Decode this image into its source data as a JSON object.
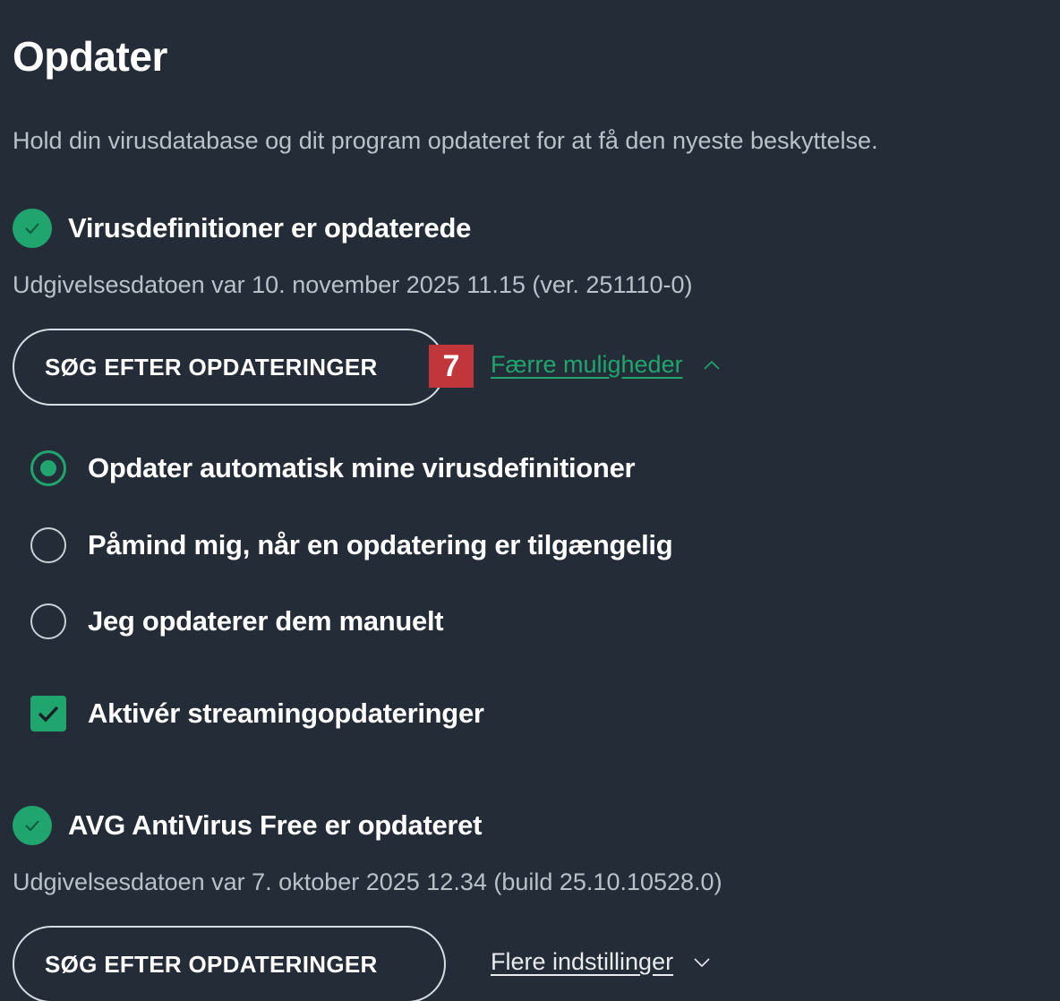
{
  "header": {
    "title": "Opdater",
    "subtitle": "Hold din virusdatabase og dit program opdateret for at få den nyeste beskyttelse."
  },
  "virus_definitions": {
    "status": "Virusdefinitioner er opdaterede",
    "release": "Udgivelsesdatoen var 10. november 2025 11.15 (ver. 251110-0)",
    "check_button": "SØG EFTER OPDATERINGER",
    "badge": "7",
    "toggle_link": "Færre muligheder",
    "options": [
      {
        "label": "Opdater automatisk mine virusdefinitioner",
        "selected": true
      },
      {
        "label": "Påmind mig, når en opdatering er tilgængelig",
        "selected": false
      },
      {
        "label": "Jeg opdaterer dem manuelt",
        "selected": false
      }
    ],
    "streaming": {
      "label": "Aktivér streamingopdateringer",
      "checked": true
    }
  },
  "program": {
    "status": "AVG AntiVirus Free er opdateret",
    "release": "Udgivelsesdatoen var 7. oktober 2025 12.34 (build 25.10.10528.0)",
    "check_button": "SØG EFTER OPDATERINGER",
    "toggle_link": "Flere indstillinger"
  },
  "colors": {
    "background": "#232c37",
    "accent": "#20a56f",
    "badge": "#c0363a"
  }
}
